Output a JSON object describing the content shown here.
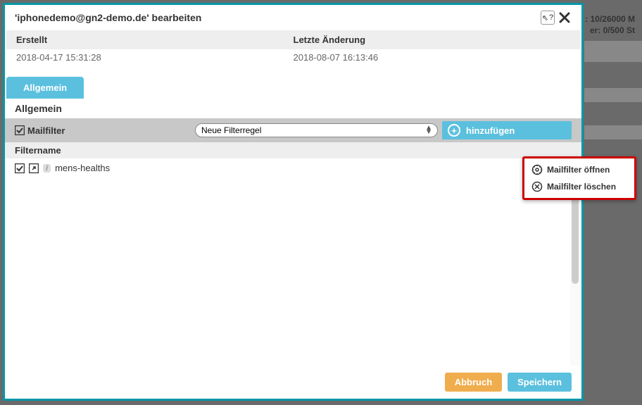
{
  "bg": {
    "line1": ": 10/26000 M",
    "line2": "er: 0/500 St"
  },
  "modal": {
    "title": "'iphonedemo@gn2-demo.de' bearbeiten",
    "help_label": "?"
  },
  "meta": {
    "created_label": "Erstellt",
    "created_value": "2018-04-17 15:31:28",
    "modified_label": "Letzte Änderung",
    "modified_value": "2018-08-07 16:13:46"
  },
  "tabs": {
    "general": "Allgemein"
  },
  "section": {
    "title": "Allgemein"
  },
  "filterbar": {
    "label": "Mailfilter",
    "select": "Neue Filterregel",
    "add": "hinzufügen"
  },
  "list": {
    "header": "Filtername",
    "items": [
      {
        "name": "mens-healths"
      }
    ]
  },
  "context": {
    "open": "Mailfilter öffnen",
    "delete": "Mailfilter löschen"
  },
  "footer": {
    "cancel": "Abbruch",
    "save": "Speichern"
  }
}
